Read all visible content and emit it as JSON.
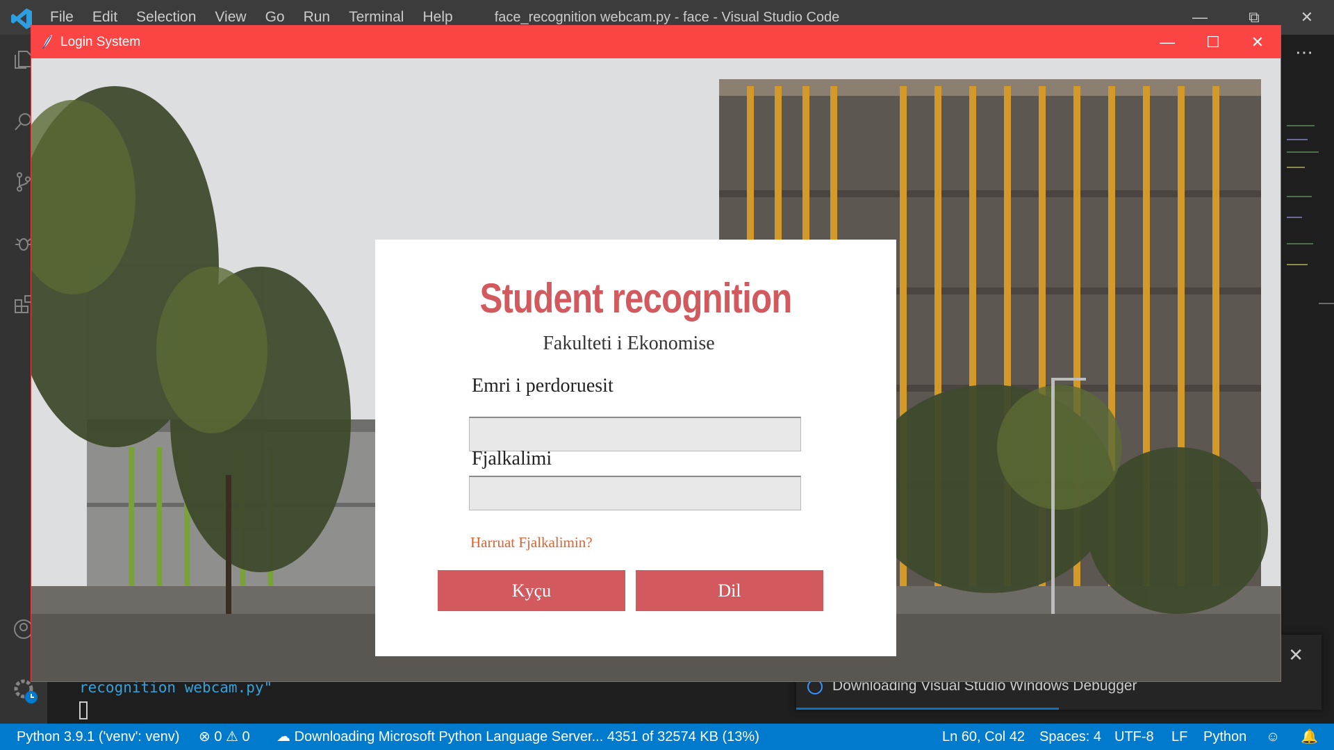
{
  "vscode": {
    "menu": [
      "File",
      "Edit",
      "Selection",
      "View",
      "Go",
      "Run",
      "Terminal",
      "Help"
    ],
    "window_title": "face_recognition webcam.py - face - Visual Studio Code",
    "terminal_line": "recognition webcam.py\"",
    "notification": "Downloading Visual Studio Windows Debugger",
    "statusbar": {
      "python": "Python 3.9.1  ('venv': venv)",
      "errors": "0",
      "warnings": "0",
      "download": "Downloading Microsoft Python Language Server... 4351 of 32574 KB (13%)",
      "position": "Ln 60, Col 42",
      "spaces": "Spaces: 4",
      "encoding": "UTF-8",
      "eol": "LF",
      "language": "Python"
    }
  },
  "login": {
    "window_title": "Login System",
    "heading": "Student recognition",
    "subheading": "Fakulteti i Ekonomise",
    "username_label": "Emri i perdoruesit",
    "password_label": "Fjalkalimi",
    "username_value": "",
    "password_value": "",
    "forgot_link": "Harruat Fjalkalimin?",
    "login_button": "Kyçu",
    "exit_button": "Dil"
  },
  "colors": {
    "login_titlebar": "#fb4444",
    "accent": "#d25a5f",
    "link": "#e0602f",
    "vscode_status": "#007acc"
  }
}
